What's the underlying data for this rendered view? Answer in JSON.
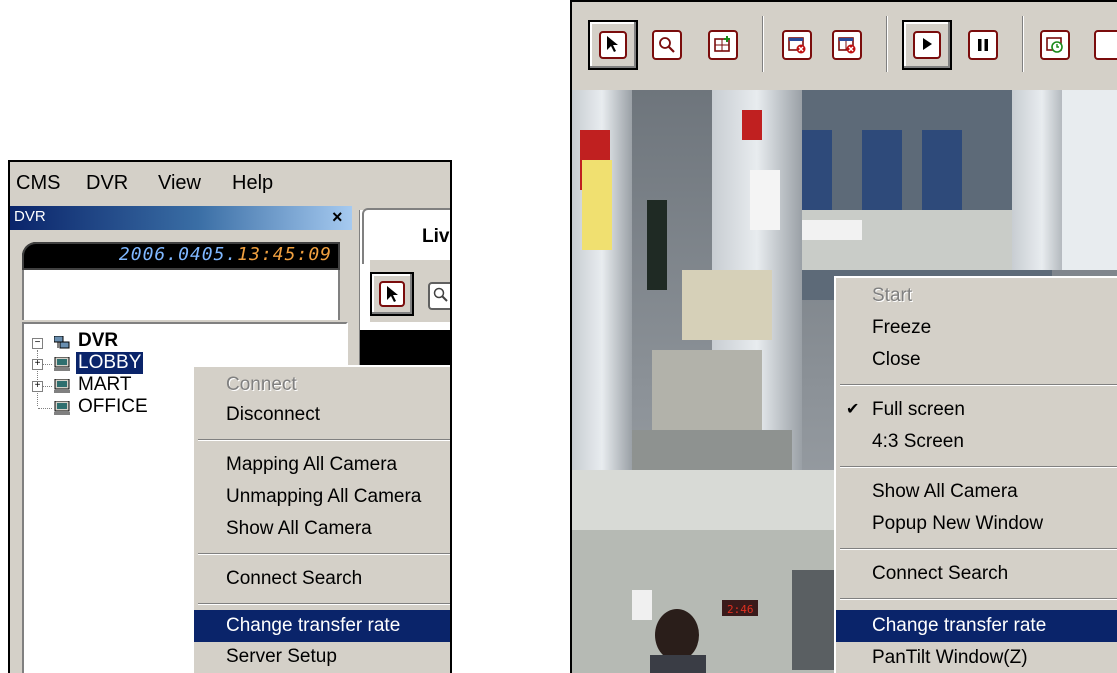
{
  "left": {
    "menu": [
      "CMS",
      "DVR",
      "View",
      "Help"
    ],
    "title": "DVR",
    "close": "×",
    "clock_date": "2006.0405.",
    "clock_time": "13:45:09",
    "live_tab": "Live",
    "tree": {
      "root": "DVR",
      "items": [
        "LOBBY",
        "MART",
        "OFFICE"
      ]
    },
    "context_menu": {
      "connect": "Connect",
      "disconnect": "Disconnect",
      "mapping_all": "Mapping All Camera",
      "unmapping_all": "Unmapping All Camera",
      "show_all": "Show All Camera",
      "connect_search": "Connect Search",
      "change_rate": "Change transfer rate",
      "server_setup": "Server Setup"
    }
  },
  "right": {
    "context_menu": {
      "start": "Start",
      "freeze": "Freeze",
      "close": "Close",
      "full_screen": "Full screen",
      "screen_43": "4:3 Screen",
      "show_all": "Show All Camera",
      "popup": "Popup New Window",
      "connect_search": "Connect Search",
      "change_rate": "Change transfer rate",
      "pantilt": "PanTilt Window(Z)"
    }
  },
  "colors": {
    "window_bg": "#d4d0c8",
    "highlight": "#0a246a",
    "titlebar_start": "#0a246a",
    "icon_accent": "#7a0c0c"
  },
  "icons": [
    "select-arrow-icon",
    "zoom-icon",
    "camera-add-icon",
    "camera-remove-icon",
    "play-icon",
    "pause-icon",
    "clock-camera-icon"
  ]
}
